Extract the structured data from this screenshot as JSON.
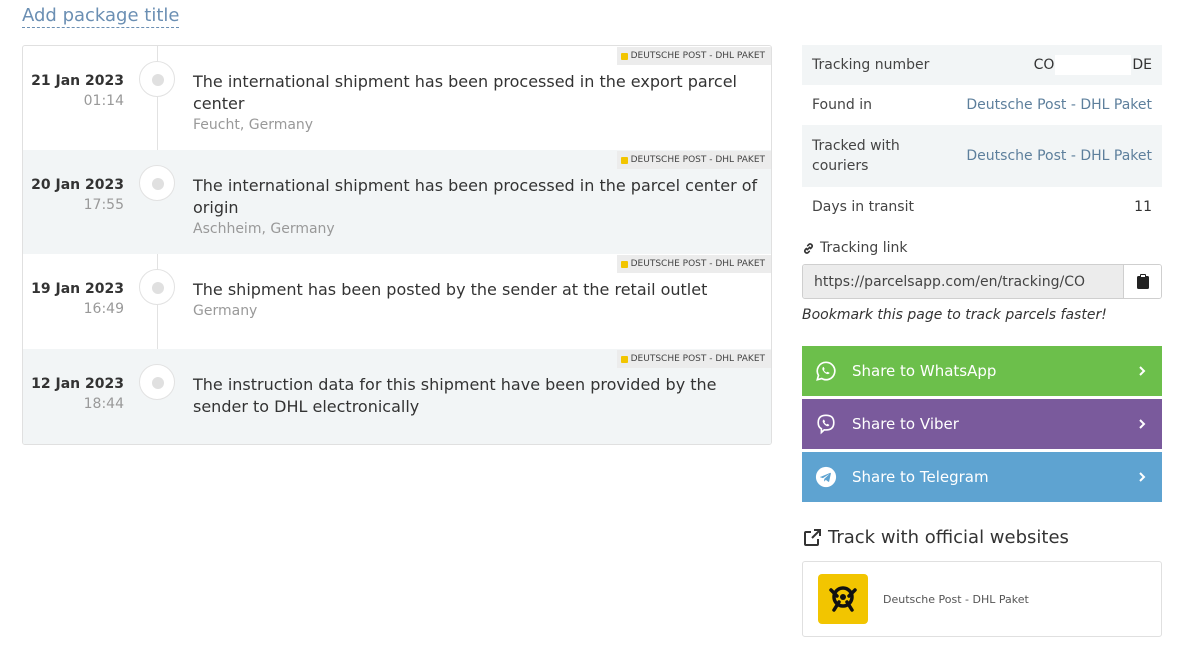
{
  "header": {
    "add_title_link": "Add package title"
  },
  "events": [
    {
      "date": "21 Jan 2023",
      "time": "01:14",
      "description": "The international shipment has been processed in the export parcel center",
      "location": "Feucht, Germany",
      "courier": "DEUTSCHE POST - DHL PAKET"
    },
    {
      "date": "20 Jan 2023",
      "time": "17:55",
      "description": "The international shipment has been processed in the parcel center of origin",
      "location": "Aschheim, Germany",
      "courier": "DEUTSCHE POST - DHL PAKET"
    },
    {
      "date": "19 Jan 2023",
      "time": "16:49",
      "description": "The shipment has been posted by the sender at the retail outlet",
      "location": "Germany",
      "courier": "DEUTSCHE POST - DHL PAKET"
    },
    {
      "date": "12 Jan 2023",
      "time": "18:44",
      "description": "The instruction data for this shipment have been provided by the sender to DHL electronically",
      "location": "",
      "courier": "DEUTSCHE POST - DHL PAKET"
    }
  ],
  "info": {
    "tracking_number_label": "Tracking number",
    "tracking_number_prefix": "CO",
    "tracking_number_suffix": "DE",
    "found_in_label": "Found in",
    "found_in_value": "Deutsche Post - DHL Paket",
    "tracked_with_label": "Tracked with couriers",
    "tracked_with_value": "Deutsche Post - DHL Paket",
    "days_label": "Days in transit",
    "days_value": "11"
  },
  "tracking_link": {
    "label": "Tracking link",
    "value": "https://parcelsapp.com/en/tracking/CO",
    "bookmark_hint": "Bookmark this page to track parcels faster!"
  },
  "share": {
    "whatsapp": "Share to WhatsApp",
    "viber": "Share to Viber",
    "telegram": "Share to Telegram"
  },
  "official": {
    "title": "Track with official websites",
    "courier_name": "Deutsche Post - DHL Paket"
  },
  "colors": {
    "whatsapp": "#6cbf4b",
    "viber": "#7a5a9c",
    "telegram": "#5ea3d1",
    "link": "#5d7f9c",
    "post_yellow": "#f2c500"
  }
}
